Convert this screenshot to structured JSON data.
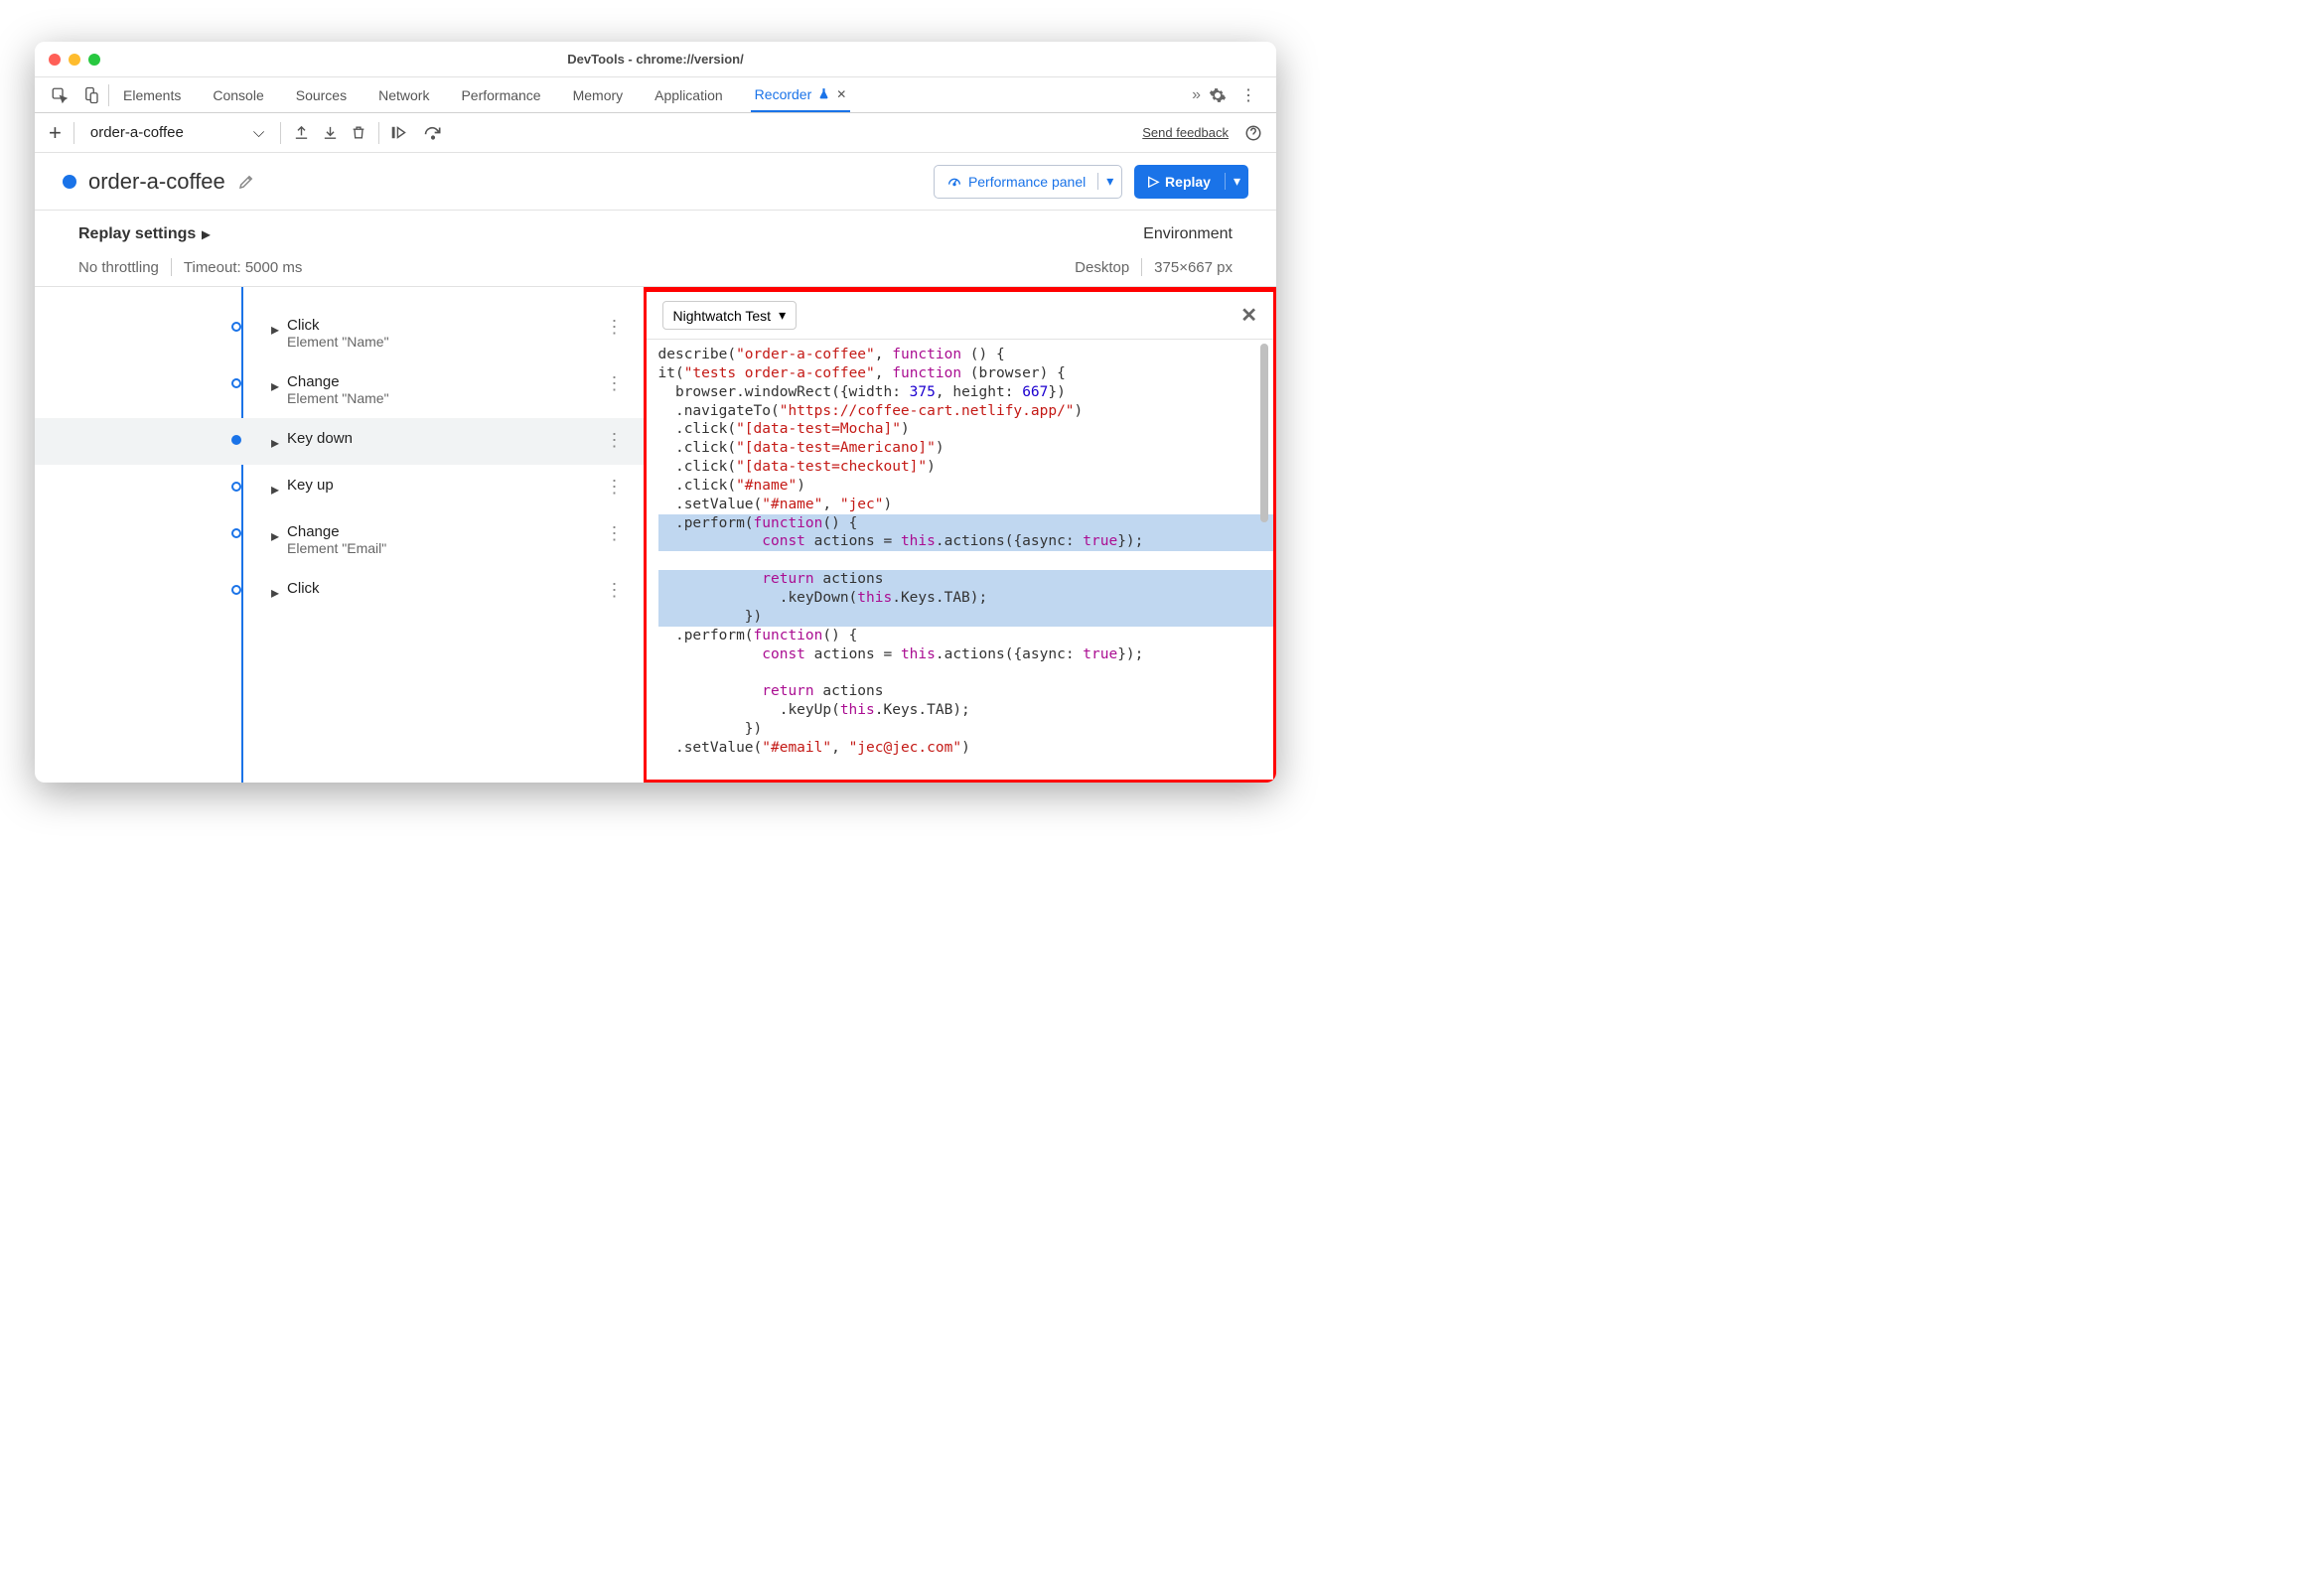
{
  "window_title": "DevTools - chrome://version/",
  "tabs": [
    "Elements",
    "Console",
    "Sources",
    "Network",
    "Performance",
    "Memory",
    "Application",
    "Recorder"
  ],
  "active_tab": "Recorder",
  "toolbar": {
    "recording_name": "order-a-coffee",
    "send_feedback": "Send feedback"
  },
  "header": {
    "title": "order-a-coffee",
    "perf_button": "Performance panel",
    "replay_button": "Replay"
  },
  "settings": {
    "title": "Replay settings",
    "throttling": "No throttling",
    "timeout": "Timeout: 5000 ms",
    "env_title": "Environment",
    "env_device": "Desktop",
    "env_dims": "375×667 px"
  },
  "steps": [
    {
      "title": "Click",
      "sub": "Element \"Name\"",
      "solid": false
    },
    {
      "title": "Change",
      "sub": "Element \"Name\"",
      "solid": false
    },
    {
      "title": "Key down",
      "sub": "",
      "solid": true,
      "hl": true
    },
    {
      "title": "Key up",
      "sub": "",
      "solid": false
    },
    {
      "title": "Change",
      "sub": "Element \"Email\"",
      "solid": false
    },
    {
      "title": "Click",
      "sub": "",
      "solid": false
    }
  ],
  "codepanel": {
    "dropdown": "Nightwatch Test"
  },
  "code_tokens": [
    [
      [
        "t",
        "describe("
      ],
      [
        "s",
        "\"order-a-coffee\""
      ],
      [
        "t",
        ", "
      ],
      [
        "k",
        "function"
      ],
      [
        "t",
        " () {"
      ]
    ],
    [
      [
        "t",
        "it("
      ],
      [
        "s",
        "\"tests order-a-coffee\""
      ],
      [
        "t",
        ", "
      ],
      [
        "k",
        "function"
      ],
      [
        "t",
        " (browser) {"
      ]
    ],
    [
      [
        "t",
        "  browser.windowRect({width: "
      ],
      [
        "n",
        "375"
      ],
      [
        "t",
        ", height: "
      ],
      [
        "n",
        "667"
      ],
      [
        "t",
        "})"
      ]
    ],
    [
      [
        "t",
        "  .navigateTo("
      ],
      [
        "s",
        "\"https://coffee-cart.netlify.app/\""
      ],
      [
        "t",
        ")"
      ]
    ],
    [
      [
        "t",
        "  .click("
      ],
      [
        "s",
        "\"[data-test=Mocha]\""
      ],
      [
        "t",
        ")"
      ]
    ],
    [
      [
        "t",
        "  .click("
      ],
      [
        "s",
        "\"[data-test=Americano]\""
      ],
      [
        "t",
        ")"
      ]
    ],
    [
      [
        "t",
        "  .click("
      ],
      [
        "s",
        "\"[data-test=checkout]\""
      ],
      [
        "t",
        ")"
      ]
    ],
    [
      [
        "t",
        "  .click("
      ],
      [
        "s",
        "\"#name\""
      ],
      [
        "t",
        ")"
      ]
    ],
    [
      [
        "t",
        "  .setValue("
      ],
      [
        "s",
        "\"#name\""
      ],
      [
        "t",
        ", "
      ],
      [
        "s",
        "\"jec\""
      ],
      [
        "t",
        ")"
      ]
    ],
    [
      [
        "t",
        "  .perform("
      ],
      [
        "k",
        "function"
      ],
      [
        "t",
        "() {"
      ]
    ],
    [
      [
        "t",
        "            "
      ],
      [
        "k",
        "const"
      ],
      [
        "t",
        " actions = "
      ],
      [
        "k",
        "this"
      ],
      [
        "t",
        ".actions({async: "
      ],
      [
        "k",
        "true"
      ],
      [
        "t",
        "});"
      ]
    ],
    [
      [
        "t",
        ""
      ]
    ],
    [
      [
        "t",
        "            "
      ],
      [
        "k",
        "return"
      ],
      [
        "t",
        " actions"
      ]
    ],
    [
      [
        "t",
        "              .keyDown("
      ],
      [
        "k",
        "this"
      ],
      [
        "t",
        ".Keys.TAB);"
      ]
    ],
    [
      [
        "t",
        "          })"
      ]
    ],
    [
      [
        "t",
        "  .perform("
      ],
      [
        "k",
        "function"
      ],
      [
        "t",
        "() {"
      ]
    ],
    [
      [
        "t",
        "            "
      ],
      [
        "k",
        "const"
      ],
      [
        "t",
        " actions = "
      ],
      [
        "k",
        "this"
      ],
      [
        "t",
        ".actions({async: "
      ],
      [
        "k",
        "true"
      ],
      [
        "t",
        "});"
      ]
    ],
    [
      [
        "t",
        ""
      ]
    ],
    [
      [
        "t",
        "            "
      ],
      [
        "k",
        "return"
      ],
      [
        "t",
        " actions"
      ]
    ],
    [
      [
        "t",
        "              .keyUp("
      ],
      [
        "k",
        "this"
      ],
      [
        "t",
        ".Keys.TAB);"
      ]
    ],
    [
      [
        "t",
        "          })"
      ]
    ],
    [
      [
        "t",
        "  .setValue("
      ],
      [
        "s",
        "\"#email\""
      ],
      [
        "t",
        ", "
      ],
      [
        "s",
        "\"jec@jec.com\""
      ],
      [
        "t",
        ")"
      ]
    ]
  ],
  "highlighted_lines": [
    9,
    10,
    11,
    12,
    13,
    14
  ]
}
